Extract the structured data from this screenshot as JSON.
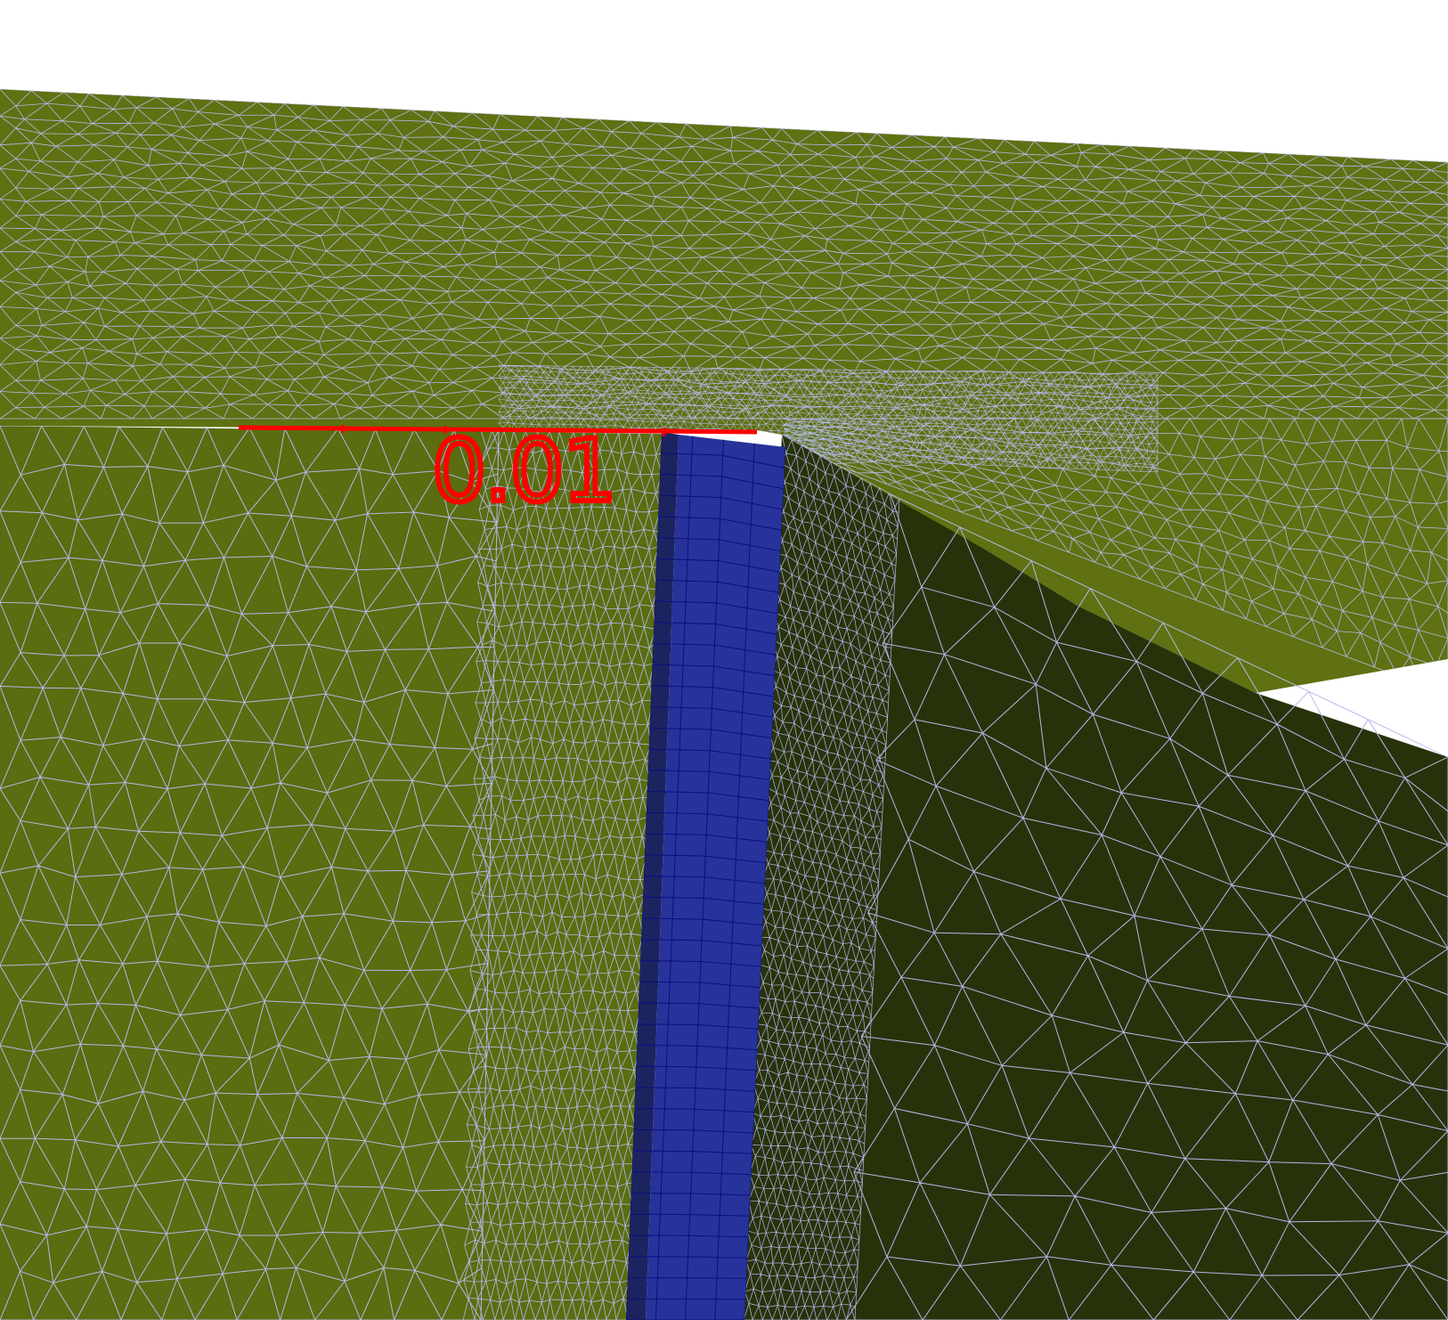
{
  "scene": {
    "background_color": "#ffffff",
    "mesh_line_color": "#b4b8e8",
    "top_surface_color": "#5f7112",
    "front_face_color": "#5a6d10",
    "side_face_color": "#28320a",
    "layer_color_light": "#27339a",
    "layer_color_dark": "#1c2460",
    "layer_line_color": "#0a0f80"
  },
  "dimension": {
    "label": "0.01",
    "color": "#ff0000"
  }
}
